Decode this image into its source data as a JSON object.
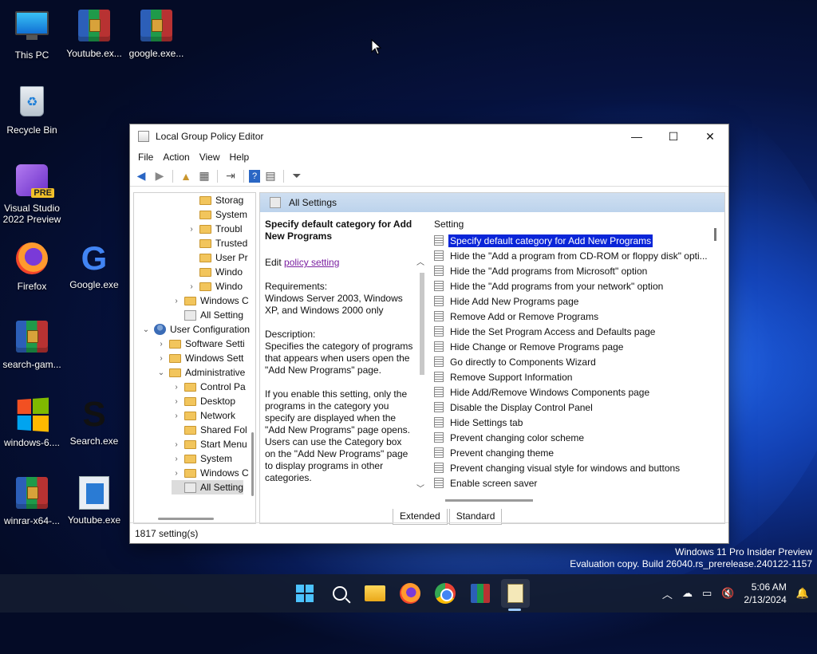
{
  "desktop_icons": [
    {
      "label": "This PC"
    },
    {
      "label": "Youtube.ex..."
    },
    {
      "label": "google.exe..."
    },
    {
      "label": "Recycle Bin"
    },
    {
      "label": "Visual Studio 2022 Preview",
      "badge": "PRE"
    },
    {
      "label": "Firefox"
    },
    {
      "label": "Google.exe",
      "glyph": "G"
    },
    {
      "label": "search-gam..."
    },
    {
      "label": "windows-6...."
    },
    {
      "label": "Search.exe",
      "glyph": "S"
    },
    {
      "label": "winrar-x64-..."
    },
    {
      "label": "Youtube.exe"
    }
  ],
  "window": {
    "title": "Local Group Policy Editor",
    "controls": {
      "minimize": "—",
      "maximize": "☐",
      "close": "✕"
    },
    "menu": [
      "File",
      "Action",
      "View",
      "Help"
    ],
    "tree": [
      {
        "label": "Storag",
        "indent": 4,
        "arrow": ""
      },
      {
        "label": "System",
        "indent": 4,
        "arrow": ""
      },
      {
        "label": "Troubl",
        "indent": 4,
        "arrow": "›"
      },
      {
        "label": "Trusted",
        "indent": 4,
        "arrow": ""
      },
      {
        "label": "User Pr",
        "indent": 4,
        "arrow": ""
      },
      {
        "label": "Windo",
        "indent": 4,
        "arrow": ""
      },
      {
        "label": "Windo",
        "indent": 4,
        "arrow": "›"
      },
      {
        "label": "Windows C",
        "indent": 3,
        "arrow": "›"
      },
      {
        "label": "All Setting",
        "indent": 3,
        "arrow": "",
        "icon": "gear"
      },
      {
        "label": "User Configuration",
        "indent": 1,
        "arrow": "⌄",
        "icon": "user"
      },
      {
        "label": "Software Setti",
        "indent": 2,
        "arrow": "›"
      },
      {
        "label": "Windows Sett",
        "indent": 2,
        "arrow": "›"
      },
      {
        "label": "Administrative",
        "indent": 2,
        "arrow": "⌄"
      },
      {
        "label": "Control Pa",
        "indent": 3,
        "arrow": "›"
      },
      {
        "label": "Desktop",
        "indent": 3,
        "arrow": "›"
      },
      {
        "label": "Network",
        "indent": 3,
        "arrow": "›"
      },
      {
        "label": "Shared Fol",
        "indent": 3,
        "arrow": ""
      },
      {
        "label": "Start Menu",
        "indent": 3,
        "arrow": "›"
      },
      {
        "label": "System",
        "indent": 3,
        "arrow": "›"
      },
      {
        "label": "Windows C",
        "indent": 3,
        "arrow": "›"
      },
      {
        "label": "All Setting",
        "indent": 3,
        "arrow": "",
        "icon": "gear",
        "selected": true
      }
    ],
    "right_header": "All Settings",
    "description": {
      "heading": "Specify default category for Add New Programs",
      "edit_prefix": "Edit ",
      "edit_link": "policy setting",
      "requirements_label": "Requirements:",
      "requirements": "Windows Server 2003, Windows XP, and Windows 2000 only",
      "description_label": "Description:",
      "description": "Specifies the category of programs that appears when users open the \"Add New Programs\" page.",
      "more": "If you enable this setting, only the programs in the category you specify are displayed when the \"Add New Programs\" page opens. Users can use the Category box on the \"Add New Programs\" page to display programs in other categories."
    },
    "list_header": "Setting",
    "settings": [
      "Specify default category for Add New Programs",
      "Hide the \"Add a program from CD-ROM or floppy disk\" opti...",
      "Hide the \"Add programs from Microsoft\" option",
      "Hide the \"Add programs from your network\" option",
      "Hide Add New Programs page",
      "Remove Add or Remove Programs",
      "Hide the Set Program Access and Defaults page",
      "Hide Change or Remove Programs page",
      "Go directly to Components Wizard",
      "Remove Support Information",
      "Hide Add/Remove Windows Components page",
      "Disable the Display Control Panel",
      "Hide Settings tab",
      "Prevent changing color scheme",
      "Prevent changing theme",
      "Prevent changing visual style for windows and buttons",
      "Enable screen saver"
    ],
    "tabs": [
      "Extended",
      "Standard"
    ],
    "status": "1817 setting(s)"
  },
  "watermark": {
    "line1": "Windows 11 Pro Insider Preview",
    "line2": "Evaluation copy. Build 26040.rs_prerelease.240122-1157"
  },
  "taskbar": {
    "time": "5:06 AM",
    "date": "2/13/2024"
  }
}
